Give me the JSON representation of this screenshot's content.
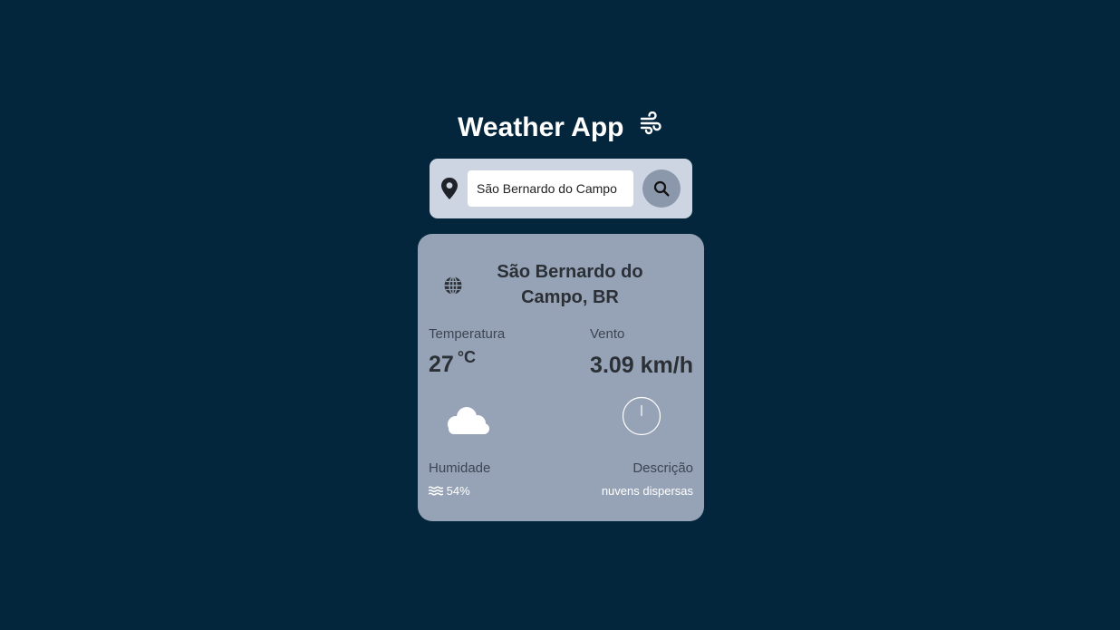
{
  "header": {
    "title": "Weather App",
    "title_icon": "wind-icon"
  },
  "search": {
    "location_icon": "map-pin-icon",
    "value": "São Bernardo do Campo",
    "button_icon": "search-icon"
  },
  "weather": {
    "location_icon": "globe-icon",
    "city": "São Bernardo do Campo, BR",
    "temperature": {
      "label": "Temperatura",
      "value": "27",
      "unit": "°C"
    },
    "wind": {
      "label": "Vento",
      "value": "3.09 km/h",
      "icon": "compass-icon"
    },
    "condition_icon": "cloud-icon",
    "humidity": {
      "label": "Humidade",
      "icon": "water-icon",
      "value": "54%"
    },
    "description": {
      "label": "Descrição",
      "value": "nuvens dispersas"
    }
  },
  "colors": {
    "background": "#04263d",
    "search_panel": "#cdd5e2",
    "card": "#96a3b6",
    "search_button": "#8b97aa"
  }
}
